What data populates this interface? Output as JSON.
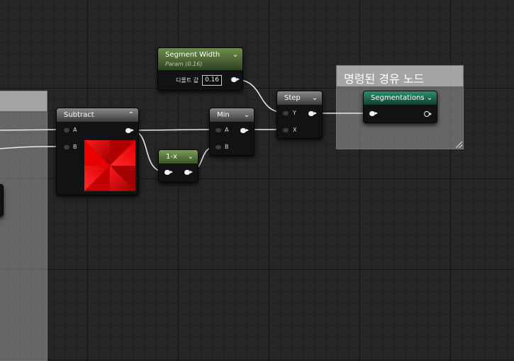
{
  "nodes": {
    "segment_width": {
      "title": "Segment Width",
      "subtitle": "Param (0.16)",
      "default_label": "디폴트 값",
      "default_value": "0.16"
    },
    "subtract": {
      "title": "Subtract",
      "pin_a": "A",
      "pin_b": "B"
    },
    "one_minus_x": {
      "title": "1-x"
    },
    "min": {
      "title": "Min",
      "pin_a": "A",
      "pin_b": "B"
    },
    "step": {
      "title": "Step",
      "pin_y": "Y",
      "pin_x": "X"
    },
    "segmentations": {
      "title": "Segmentations"
    }
  },
  "comments": {
    "named_reroute": {
      "title": "명령된 경유 노드"
    }
  },
  "colors": {
    "param_header": "#6c8e4a",
    "named_reroute_header": "#2f8f6e",
    "preview_red": "#d40000",
    "wire": "#e8e8e8"
  }
}
